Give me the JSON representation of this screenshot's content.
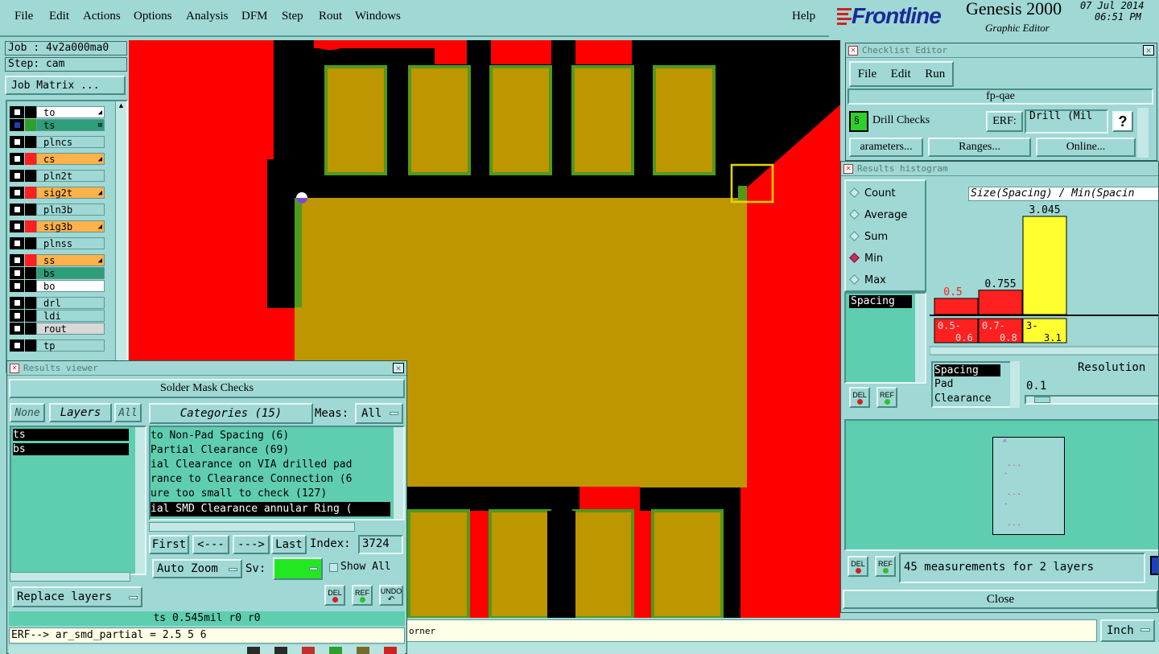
{
  "menu": {
    "items": [
      "File",
      "Edit",
      "Actions",
      "Options",
      "Analysis",
      "DFM",
      "Step",
      "Rout",
      "Windows"
    ],
    "help": "Help"
  },
  "brand": {
    "logo": "Frontline",
    "product": "Genesis 2000",
    "subtitle": "Graphic Editor",
    "date": "07 Jul 2014",
    "time": "06:51 PM"
  },
  "job": {
    "job": "Job : 4v2a000ma0",
    "step": "Step: cam",
    "matrix": "Job Matrix ..."
  },
  "layers": [
    {
      "name": "to",
      "color": "#ffffff",
      "cb": "#ffffff",
      "mark": "◢"
    },
    {
      "name": "ts",
      "color": "#2e9e78",
      "cb": "#1e3fb0",
      "mark": "⊞",
      "active": true
    },
    {
      "name": "plncs",
      "color": "#9fd8d4",
      "cb": "#ffffff",
      "mark": ""
    },
    {
      "name": "cs",
      "color": "#ffb14a",
      "cb": "#ffffff",
      "mark": "◢"
    },
    {
      "name": "pln2t",
      "color": "#9fd8d4",
      "cb": "#ffffff",
      "mark": ""
    },
    {
      "name": "sig2t",
      "color": "#ffb14a",
      "cb": "#ffffff",
      "mark": "◢"
    },
    {
      "name": "pln3b",
      "color": "#9fd8d4",
      "cb": "#ffffff",
      "mark": ""
    },
    {
      "name": "sig3b",
      "color": "#ffb14a",
      "cb": "#ffffff",
      "mark": "◢"
    },
    {
      "name": "plnss",
      "color": "#9fd8d4",
      "cb": "#ffffff",
      "mark": ""
    },
    {
      "name": "ss",
      "color": "#ffb14a",
      "cb": "#ffffff",
      "mark": "◢"
    },
    {
      "name": "bs",
      "color": "#2e9e78",
      "cb": "#ffffff",
      "mark": ""
    },
    {
      "name": "bo",
      "color": "#ffffff",
      "cb": "#ffffff",
      "mark": ""
    },
    {
      "name": "drl",
      "color": "#9fd8d4",
      "cb": "#ffffff",
      "mark": ""
    },
    {
      "name": "ldi",
      "color": "#9fd8d4",
      "cb": "#ffffff",
      "mark": ""
    },
    {
      "name": "rout",
      "color": "#d8d8d8",
      "cb": "#ffffff",
      "mark": ""
    },
    {
      "name": "tp",
      "color": "#9fd8d4",
      "cb": "#ffffff",
      "mark": ""
    }
  ],
  "checklist": {
    "title": "Checklist Editor",
    "menu": [
      "File",
      "Edit",
      "Run"
    ],
    "name": "fp-qae",
    "action": "Drill Checks",
    "erf_label": "ERF:",
    "erf_value": "Drill (Mil",
    "help": "?",
    "buttons": [
      "arameters...",
      "Ranges...",
      "Online..."
    ]
  },
  "histogram": {
    "title": "Results histogram",
    "modes": [
      "Count",
      "Average",
      "Sum",
      "Min",
      "Max"
    ],
    "selected_mode": "Min",
    "chart_title": "Size(Spacing) / Min(Spacin",
    "list": [
      "Spacing"
    ],
    "types": [
      "Spacing",
      "Pad",
      "Clearance"
    ],
    "resolution_label": "Resolution",
    "resolution_value": "0.1",
    "del": "DEL",
    "ref": "REF",
    "summary": "45 measurements for 2 layers",
    "close": "Close"
  },
  "chart_data": {
    "type": "bar",
    "title": "Size(Spacing) / Min(Spacin",
    "categories": [
      "0.5-0.6",
      "0.7-0.8",
      "3-3.1"
    ],
    "range_top": [
      "0.5-",
      "0.7-",
      "3-"
    ],
    "range_bottom": [
      "0.6",
      "0.8",
      "3.1"
    ],
    "values": [
      0.5,
      0.755,
      3.045
    ],
    "value_labels": [
      "0.5",
      "0.755",
      "3.045"
    ],
    "colors": [
      "#ff2020",
      "#ff2020",
      "#ffff30"
    ]
  },
  "results": {
    "title": "Results viewer",
    "heading": "Solder Mask Checks",
    "none": "None",
    "layers": "Layers",
    "all": "All",
    "categories": "Categories (15)",
    "meas_label": "Meas:",
    "meas_value": "All",
    "layer_items": [
      "ts",
      "bs"
    ],
    "category_items": [
      " to Non-Pad Spacing (6)",
      " Partial Clearance (69)",
      "ial Clearance on VIA drilled pad",
      "rance to Clearance Connection (6",
      "ure too small to check (127)",
      "ial SMD Clearance annular Ring ("
    ],
    "nav": [
      "First",
      "<---",
      "--->",
      "Last"
    ],
    "index_label": "Index:",
    "index_value": "3724",
    "zoom": "Auto Zoom",
    "sv": "Sv:",
    "show_all": "Show All",
    "replace": "Replace layers",
    "del": "DEL",
    "ref": "REF",
    "undo": "UNDO",
    "status": "ts 0.545mil  r0  r0",
    "erf": "ERF--> ar_smd_partial = 2.5 5 6"
  },
  "statusbar": {
    "text": "orner",
    "unit": "Inch"
  }
}
